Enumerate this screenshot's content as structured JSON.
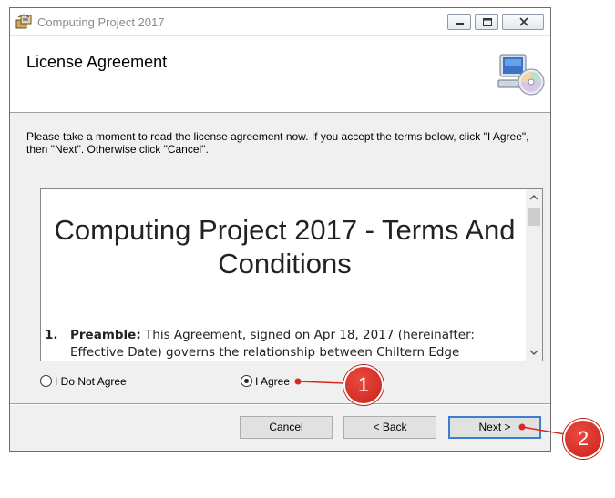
{
  "window": {
    "title": "Computing Project 2017",
    "buttons": [
      "minimize-icon",
      "maximize-icon",
      "close-icon"
    ]
  },
  "header": {
    "title": "License Agreement",
    "icon": "computer-cd-icon"
  },
  "instructions": "Please take a moment to read the license agreement now. If you accept the terms below, click \"I Agree\", then \"Next\". Otherwise click \"Cancel\".",
  "license": {
    "heading": "Computing Project 2017 - Terms And Conditions",
    "item_number": "1.",
    "item_title": "Preamble:",
    "item_text": " This Agreement, signed on Apr 18, 2017 (hereinafter: Effective Date) governs the relationship between Chiltern Edge"
  },
  "options": {
    "disagree": "I Do Not Agree",
    "agree": "I Agree",
    "selected": "agree"
  },
  "buttons": {
    "cancel": "Cancel",
    "back": "< Back",
    "next": "Next >"
  },
  "callouts": [
    "1",
    "2"
  ],
  "colors": {
    "callout_red": "#d8291f",
    "default_button_border": "#3c7fd1"
  }
}
